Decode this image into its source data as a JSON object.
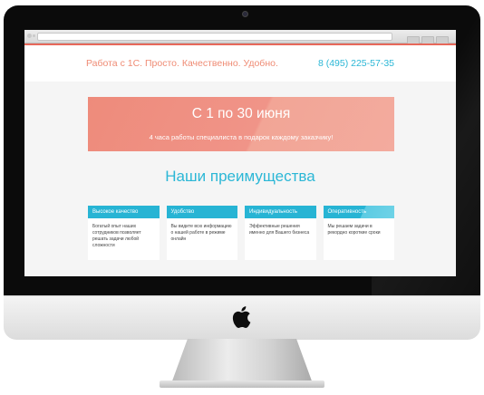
{
  "site": {
    "tagline": "Работа с 1С. Просто. Качественно. Удобно.",
    "phone": "8 (495) 225-57-35"
  },
  "banner": {
    "title": "С 1 по 30 июня",
    "subtitle": "4 часа работы специалиста в подарок каждому заказчику!"
  },
  "advantages": {
    "title": "Наши преимущества",
    "cards": [
      {
        "title": "Высокое качество",
        "text": "Богатый опыт наших сотрудников позволяет решать задачи любой сложности"
      },
      {
        "title": "Удобство",
        "text": "Вы видите всю информацию о нашей работе в режиме онлайн"
      },
      {
        "title": "Индивидуальность",
        "text": "Эффективные решения именно для Вашего бизнеса"
      },
      {
        "title": "Оперативность",
        "text": "Мы решаем задачи в рекордно короткие сроки"
      }
    ]
  },
  "colors": {
    "accent_coral": "#ef8b74",
    "accent_cyan": "#2bb7d6",
    "card_header": "#27b4d4",
    "banner": "#ee8b7b"
  },
  "icons": {
    "logo": "apple-logo-icon",
    "camera": "camera-icon"
  }
}
